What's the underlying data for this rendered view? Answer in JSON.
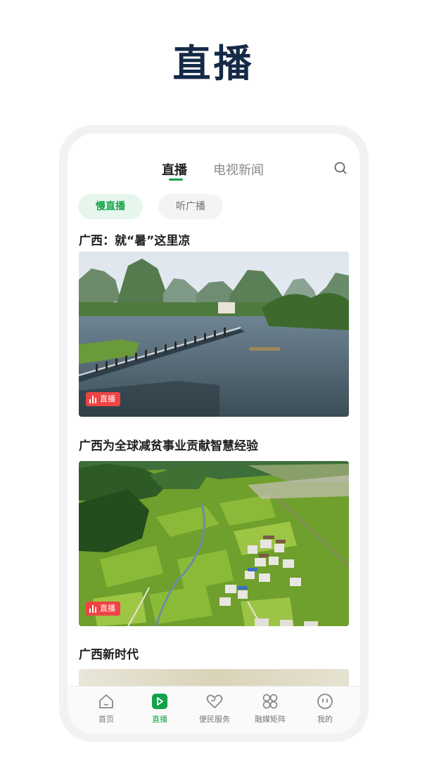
{
  "hero": {
    "title": "直播"
  },
  "top_tabs": {
    "live": "直播",
    "tv_news": "电视新闻"
  },
  "filters": {
    "slow_live": "慢直播",
    "radio": "听广播"
  },
  "cards": [
    {
      "title": "广西：就“暑”这里凉",
      "badge": "直播"
    },
    {
      "title": "广西为全球减贫事业贡献智慧经验",
      "badge": "直播"
    },
    {
      "title": "广西新时代"
    }
  ],
  "bottom_tabs": [
    {
      "label": "首页",
      "icon": "home-icon"
    },
    {
      "label": "直播",
      "icon": "play-icon",
      "active": true
    },
    {
      "label": "便民服务",
      "icon": "heart-service-icon"
    },
    {
      "label": "融媒矩阵",
      "icon": "grid-icon"
    },
    {
      "label": "我的",
      "icon": "smiley-icon"
    }
  ],
  "colors": {
    "accent": "#12a34a",
    "badge": "#ef4444",
    "hero_text": "#152a47"
  }
}
